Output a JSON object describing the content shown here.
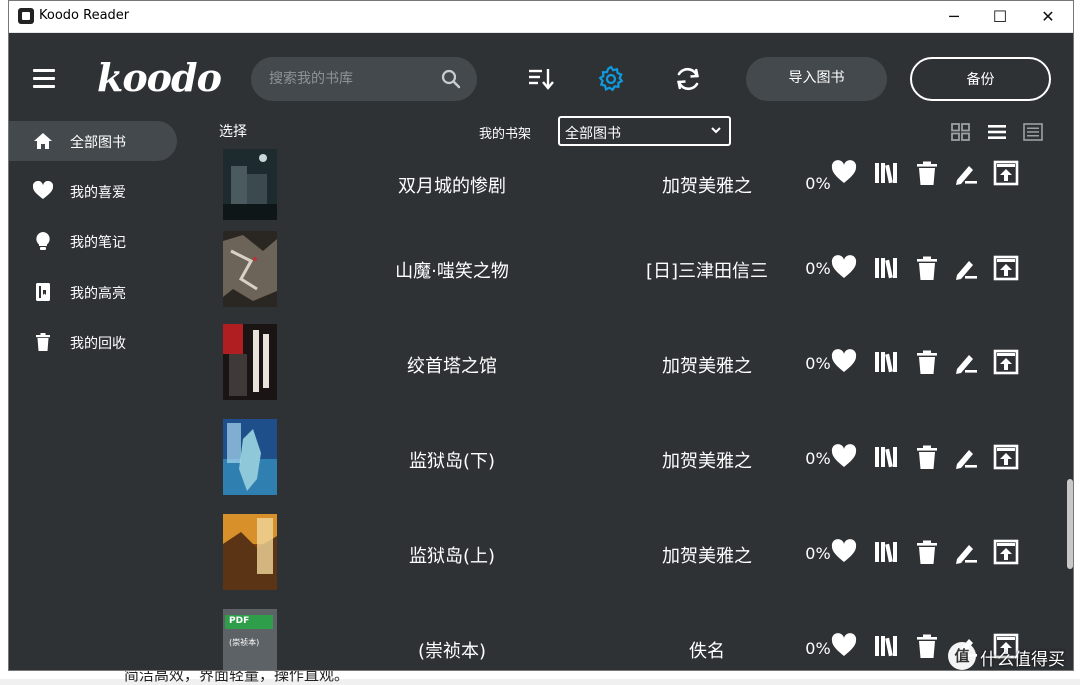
{
  "window": {
    "title": "Koodo Reader",
    "controls": [
      "─",
      "☐",
      "✕"
    ]
  },
  "header": {
    "logo": "koodo",
    "search_placeholder": "搜索我的书库",
    "import_label": "导入图书",
    "backup_label": "备份",
    "accent_color": "#0f9be0"
  },
  "sidebar": {
    "items": [
      {
        "label": "全部图书",
        "icon": "home-icon",
        "active": true
      },
      {
        "label": "我的喜爱",
        "icon": "heart-icon",
        "active": false
      },
      {
        "label": "我的笔记",
        "icon": "lightbulb-icon",
        "active": false
      },
      {
        "label": "我的高亮",
        "icon": "highlight-book-icon",
        "active": false
      },
      {
        "label": "我的回收",
        "icon": "trash-icon",
        "active": false
      }
    ]
  },
  "toolbar": {
    "select_label": "选择",
    "shelf_label": "我的书架",
    "shelf_value": "全部图书",
    "views": [
      "grid-view-icon",
      "list-view-icon",
      "cover-view-icon"
    ]
  },
  "books": [
    {
      "title": "双月城的惨剧",
      "author": "加贺美雅之",
      "progress": "0%"
    },
    {
      "title": "山魔·嗤笑之物",
      "author": "[日]三津田信三",
      "progress": "0%"
    },
    {
      "title": "绞首塔之馆",
      "author": "加贺美雅之",
      "progress": "0%"
    },
    {
      "title": "监狱岛(下)",
      "author": "加贺美雅之",
      "progress": "0%"
    },
    {
      "title": "监狱岛(上)",
      "author": "加贺美雅之",
      "progress": "0%"
    },
    {
      "title": "(崇祯本)",
      "author": "佚名",
      "progress": "0%"
    }
  ],
  "cover_pdf": {
    "tag": "PDF",
    "caption": "(崇祯本)"
  },
  "row_actions": [
    "heart-icon",
    "shelf-icon",
    "delete-icon",
    "edit-icon",
    "export-icon"
  ],
  "backdrop_text": "简洁高效，界面轻量，操作直观。",
  "watermark": {
    "badge": "值",
    "text": "什么值得买"
  }
}
